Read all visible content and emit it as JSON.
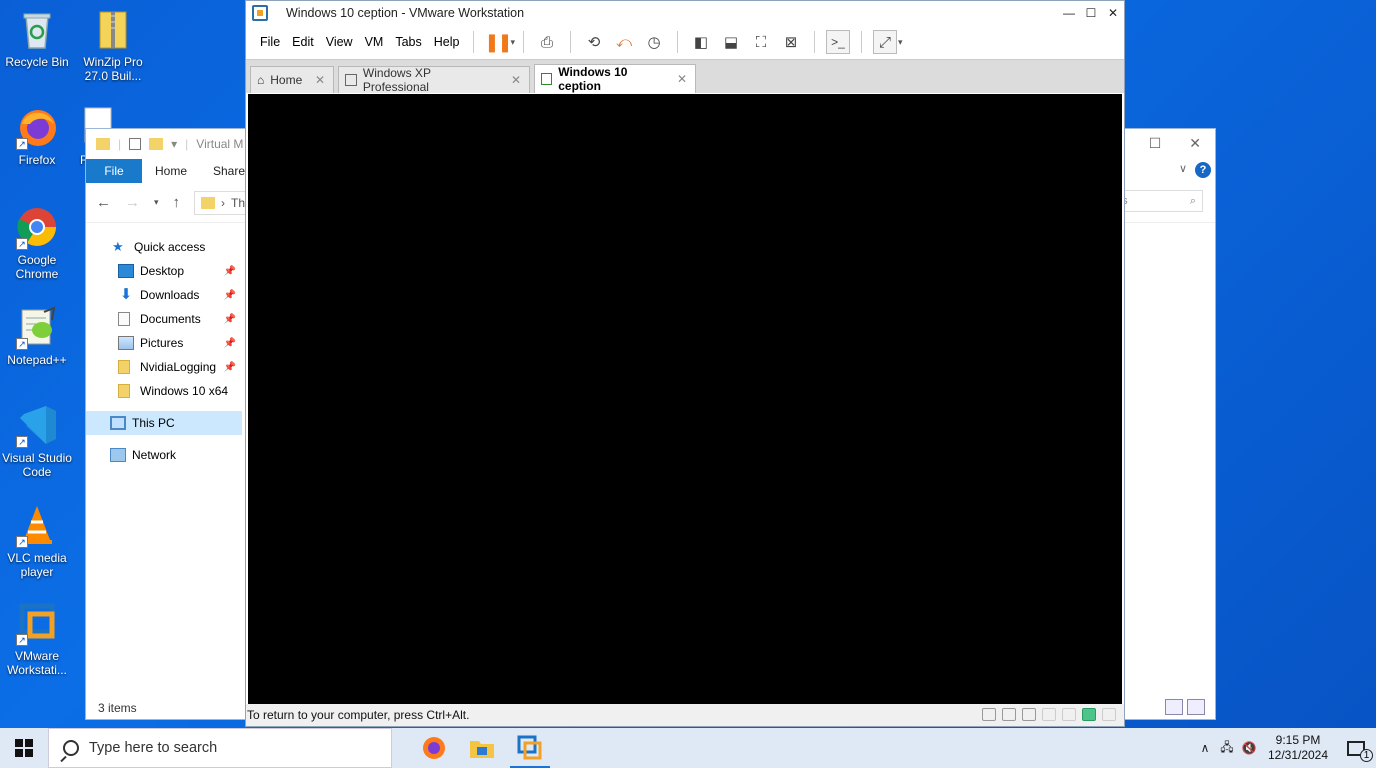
{
  "desktop": {
    "icons": [
      {
        "label": "Recycle Bin",
        "icon": "recycle-bin-icon"
      },
      {
        "label": "WinZip Pro 27.0 Buil...",
        "icon": "winzip-icon"
      },
      {
        "label": "Firefox",
        "icon": "firefox-icon"
      },
      {
        "label": "F",
        "icon": "file-icon"
      },
      {
        "label": "Google Chrome",
        "icon": "chrome-icon"
      },
      {
        "label": "Notepad++",
        "icon": "notepadpp-icon"
      },
      {
        "label": "Visual Studio Code",
        "icon": "vscode-icon"
      },
      {
        "label": "VLC media player",
        "icon": "vlc-icon"
      },
      {
        "label": "VMware Workstati...",
        "icon": "vmware-icon"
      }
    ]
  },
  "explorer": {
    "title_partial": "Virtual M",
    "ribbon": {
      "file": "File",
      "home": "Home",
      "share": "Share"
    },
    "address_partial": "Th",
    "search_partial": "es",
    "tree": [
      {
        "label": "Quick access",
        "icon": "star-icon",
        "pinned": false
      },
      {
        "label": "Desktop",
        "icon": "desktop-icon",
        "pinned": true
      },
      {
        "label": "Downloads",
        "icon": "download-icon",
        "pinned": true
      },
      {
        "label": "Documents",
        "icon": "document-icon",
        "pinned": true
      },
      {
        "label": "Pictures",
        "icon": "pictures-icon",
        "pinned": true
      },
      {
        "label": "NvidiaLogging",
        "icon": "folder-icon",
        "pinned": true
      },
      {
        "label": "Windows 10 x64",
        "icon": "folder-icon",
        "pinned": false
      },
      {
        "label": "This PC",
        "icon": "computer-icon",
        "pinned": false
      },
      {
        "label": "Network",
        "icon": "network-icon",
        "pinned": false
      }
    ],
    "status": "3 items",
    "help_label": "?"
  },
  "vmware": {
    "title": "Windows 10 ception - VMware Workstation",
    "menu": [
      "File",
      "Edit",
      "View",
      "VM",
      "Tabs",
      "Help"
    ],
    "tabs": [
      {
        "label": "Home",
        "active": false
      },
      {
        "label": "Windows XP Professional",
        "active": false
      },
      {
        "label": "Windows 10 ception",
        "active": true
      }
    ],
    "status_text": "To return to your computer, press Ctrl+Alt."
  },
  "taskbar": {
    "search_placeholder": "Type here to search",
    "time": "9:15 PM",
    "date": "12/31/2024",
    "notification_count": "1"
  },
  "colors": {
    "desktop_bg": "#0b6ee6",
    "ribbon_file": "#1979ca",
    "vm_screen": "#000000",
    "pause_orange": "#f07a1a",
    "taskbar": "#dfe9f5"
  }
}
